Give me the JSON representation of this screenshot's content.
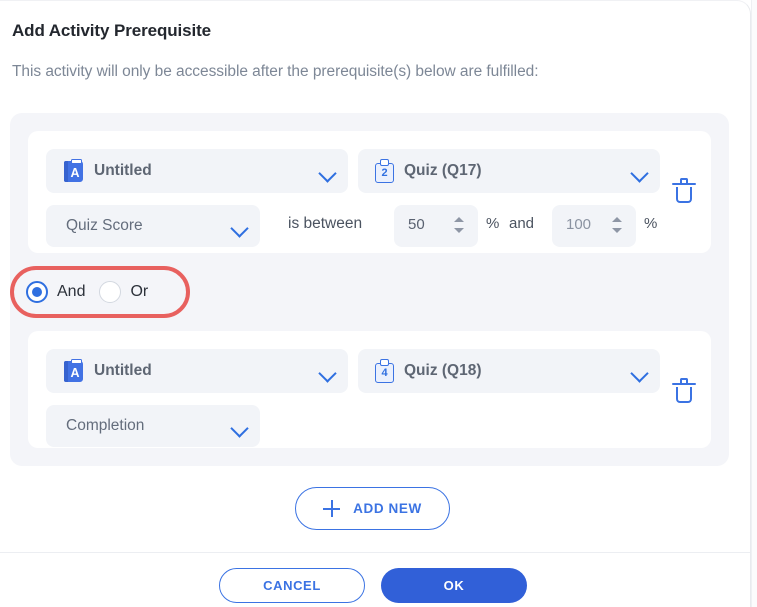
{
  "dialog": {
    "title": "Add Activity Prerequisite",
    "subtitle": "This activity will only be accessible after the prerequisite(s) below are fulfilled:"
  },
  "colors": {
    "accent": "#3b73e3",
    "primary_button": "#3160d8",
    "panel": "#f4f5f9",
    "field": "#f2f4f8",
    "annotation": "#e8615f",
    "muted_text": "#7d8796"
  },
  "rules": [
    {
      "activity": {
        "label": "Untitled",
        "icon": "activity-icon",
        "icon_glyph": "A"
      },
      "target": {
        "label": "Quiz (Q17)",
        "icon": "quiz-clipboard-icon",
        "icon_glyph": "2"
      },
      "condition": {
        "label": "Quiz Score"
      },
      "operator": "is between",
      "min": {
        "value": "50",
        "unit": "%"
      },
      "and_word": "and",
      "max": {
        "value": "100",
        "unit": "%"
      },
      "delete_icon": "trash-icon"
    },
    {
      "activity": {
        "label": "Untitled",
        "icon": "activity-icon",
        "icon_glyph": "A"
      },
      "target": {
        "label": "Quiz (Q18)",
        "icon": "quiz-clipboard-icon",
        "icon_glyph": "4"
      },
      "condition": {
        "label": "Completion"
      },
      "delete_icon": "trash-icon"
    }
  ],
  "logic": {
    "selected": "And",
    "options": [
      {
        "label": "And",
        "selected": true
      },
      {
        "label": "Or",
        "selected": false
      }
    ],
    "highlighted": true
  },
  "add_new": {
    "label": "ADD NEW",
    "icon": "plus-icon"
  },
  "footer": {
    "cancel_label": "CANCEL",
    "ok_label": "OK"
  }
}
